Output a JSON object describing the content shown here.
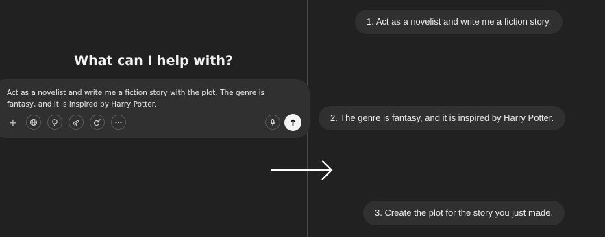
{
  "left": {
    "heading": "What can I help with?",
    "composer": {
      "text": "Act as a novelist and write me a fiction story with the plot. The genre is fantasy, and it is inspired by Harry Potter.",
      "tools": [
        "plus-icon",
        "globe-icon",
        "lightbulb-icon",
        "telescope-icon",
        "paintbrush-icon",
        "more-icon"
      ],
      "mic": "microphone-icon",
      "send": "arrow-up-icon"
    }
  },
  "arrow": "right-arrow-icon",
  "right": {
    "messages": [
      "1. Act as a novelist and write me a fiction story.",
      "2. The genre is fantasy, and it is inspired by Harry Potter.",
      "3. Create the plot for the story you just made."
    ]
  },
  "colors": {
    "background": "#212121",
    "surface": "#303030",
    "text": "#ececec"
  }
}
